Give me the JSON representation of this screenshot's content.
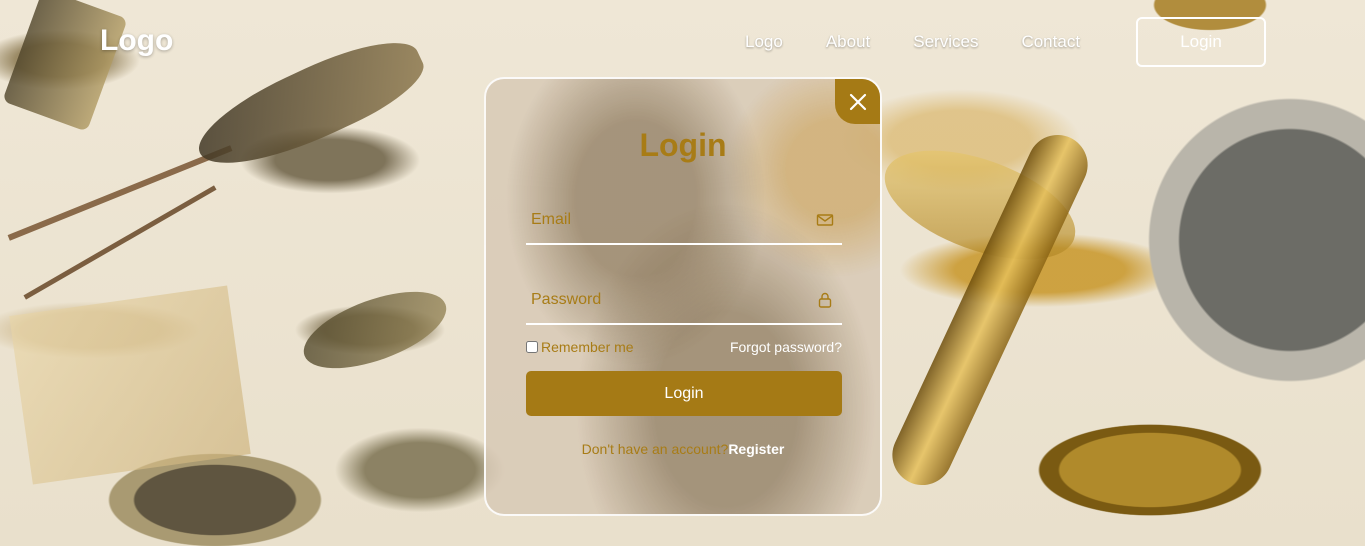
{
  "nav": {
    "logo": "Logo",
    "links": [
      "Logo",
      "About",
      "Services",
      "Contact"
    ],
    "login_button": "Login"
  },
  "modal": {
    "title": "Login",
    "email_placeholder": "Email",
    "password_placeholder": "Password",
    "remember_label": "Remember me",
    "forgot_label": "Forgot password?",
    "submit_label": "Login",
    "register_prompt": "Don't have an account?",
    "register_link": "Register"
  },
  "colors": {
    "accent": "#a57a15",
    "accent_text": "#a87c16"
  },
  "icons": {
    "close": "close-icon",
    "email": "envelope-icon",
    "password": "lock-icon"
  }
}
